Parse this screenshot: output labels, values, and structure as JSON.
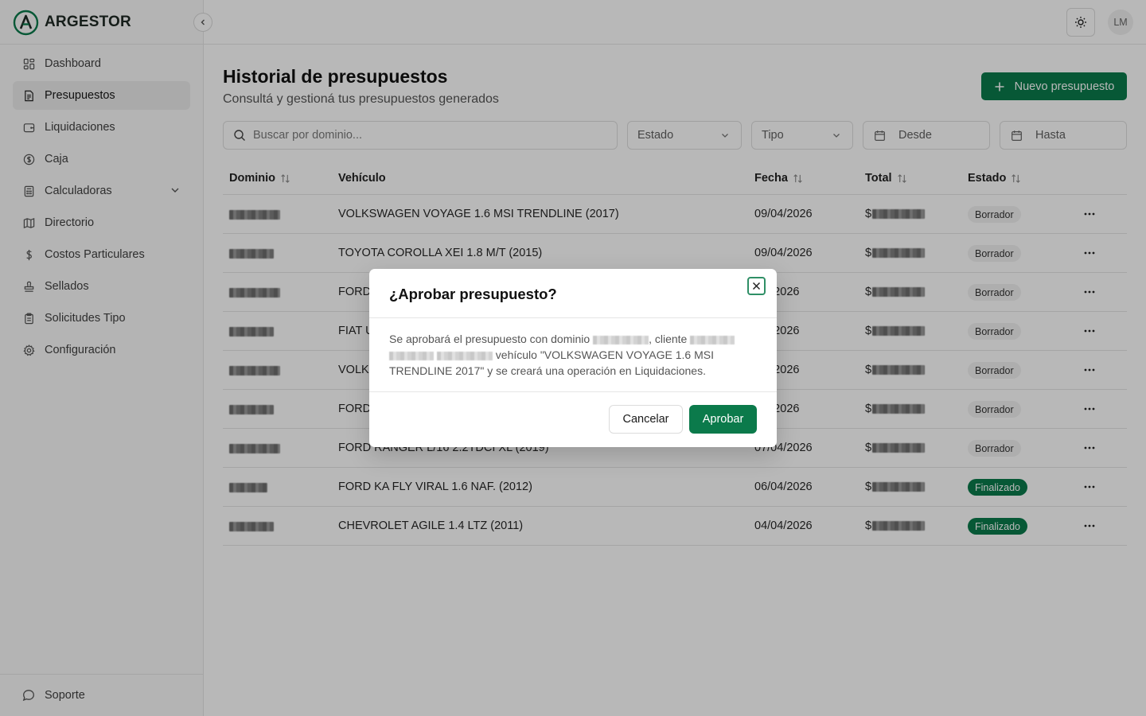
{
  "app": {
    "brand_name": "ARGESTOR",
    "user_initials": "LM"
  },
  "sidebar": {
    "items": [
      {
        "label": "Dashboard",
        "icon": "dashboard-icon"
      },
      {
        "label": "Presupuestos",
        "icon": "document-icon",
        "active": true
      },
      {
        "label": "Liquidaciones",
        "icon": "wallet-icon"
      },
      {
        "label": "Caja",
        "icon": "dollar-circle-icon"
      },
      {
        "label": "Calculadoras",
        "icon": "calculator-icon",
        "expandable": true
      },
      {
        "label": "Directorio",
        "icon": "map-icon"
      },
      {
        "label": "Costos Particulares",
        "icon": "dollar-icon"
      },
      {
        "label": "Sellados",
        "icon": "stamp-icon"
      },
      {
        "label": "Solicitudes Tipo",
        "icon": "clipboard-icon"
      },
      {
        "label": "Configuración",
        "icon": "gear-icon"
      }
    ],
    "support_label": "Soporte"
  },
  "page": {
    "title": "Historial de presupuestos",
    "subtitle": "Consultá y gestioná tus presupuestos generados",
    "new_button_label": "Nuevo presupuesto"
  },
  "filters": {
    "search_placeholder": "Buscar por dominio...",
    "estado_label": "Estado",
    "tipo_label": "Tipo",
    "desde_label": "Desde",
    "hasta_label": "Hasta"
  },
  "table": {
    "columns": {
      "dominio": "Dominio",
      "vehiculo": "Vehículo",
      "fecha": "Fecha",
      "total": "Total",
      "estado": "Estado"
    },
    "currency_symbol": "$",
    "rows": [
      {
        "vehiculo": "VOLKSWAGEN VOYAGE 1.6 MSI TRENDLINE (2017)",
        "fecha": "09/04/2026",
        "estado": "Borrador"
      },
      {
        "vehiculo": "TOYOTA COROLLA XEI 1.8 M/T (2015)",
        "fecha": "09/04/2026",
        "estado": "Borrador"
      },
      {
        "vehiculo": "FORD",
        "fecha": "/04/2026",
        "estado": "Borrador"
      },
      {
        "vehiculo": "FIAT U",
        "fecha": "/04/2026",
        "estado": "Borrador"
      },
      {
        "vehiculo": "VOLKS",
        "fecha": "/04/2026",
        "estado": "Borrador"
      },
      {
        "vehiculo": "FORD",
        "fecha": "/04/2026",
        "estado": "Borrador"
      },
      {
        "vehiculo": "FORD RANGER L/16 2.2TDCI XL (2019)",
        "fecha": "07/04/2026",
        "estado": "Borrador"
      },
      {
        "vehiculo": "FORD KA FLY VIRAL 1.6 NAF. (2012)",
        "fecha": "06/04/2026",
        "estado": "Finalizado"
      },
      {
        "vehiculo": "CHEVROLET AGILE 1.4 LTZ (2011)",
        "fecha": "04/04/2026",
        "estado": "Finalizado"
      }
    ]
  },
  "dialog": {
    "title": "¿Aprobar presupuesto?",
    "body_part1": "Se aprobará el presupuesto con dominio",
    "body_part2": ", cliente",
    "body_part3": "vehículo \"VOLKSWAGEN VOYAGE 1.6 MSI TRENDLINE 2017\" y se creará una operación en Liquidaciones.",
    "cancel_label": "Cancelar",
    "approve_label": "Aprobar"
  },
  "colors": {
    "accent": "#0b7a4b",
    "border": "#e5e5e5",
    "draft_badge": "#f2f2f2"
  }
}
